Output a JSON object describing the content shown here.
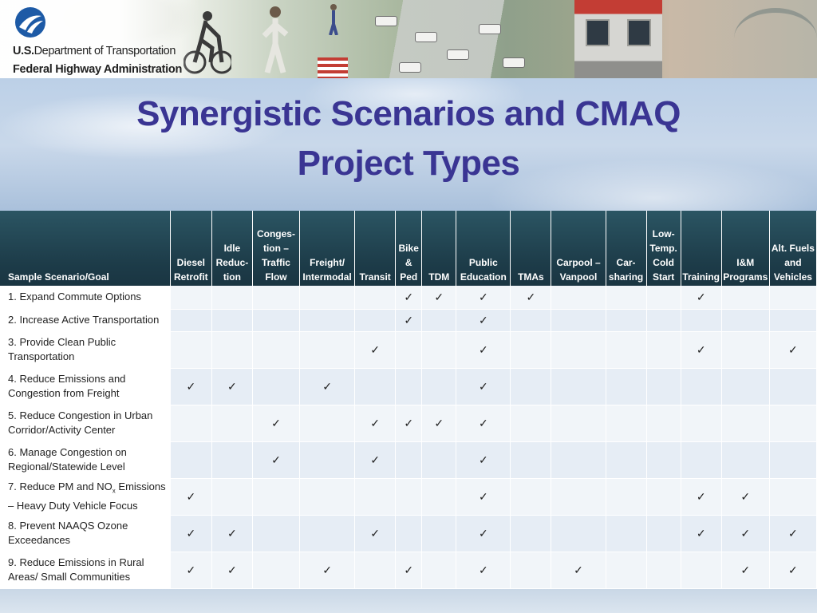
{
  "agency": {
    "line1_bold": "U.S.",
    "line1_rest": "Department of Transportation",
    "line2": "Federal Highway Administration"
  },
  "title": {
    "line1": "Synergistic Scenarios and CMAQ",
    "line2": "Project Types"
  },
  "table": {
    "headers": [
      [
        "Sample Scenario/Goal"
      ],
      [
        "Diesel",
        "Retrofit"
      ],
      [
        "Idle",
        "Reduc-",
        "tion"
      ],
      [
        "Conges-",
        "tion –",
        "Traffic",
        "Flow"
      ],
      [
        "Freight/",
        "Intermodal"
      ],
      [
        "Transit"
      ],
      [
        "Bike",
        "&",
        "Ped"
      ],
      [
        "TDM"
      ],
      [
        "Public",
        "Education"
      ],
      [
        "TMAs"
      ],
      [
        "Carpool –",
        "Vanpool"
      ],
      [
        "Car-",
        "sharing"
      ],
      [
        "Low-",
        "Temp.",
        "Cold",
        "Start"
      ],
      [
        "Training"
      ],
      [
        "I&M",
        "Programs"
      ],
      [
        "Alt. Fuels",
        "and",
        "Vehicles"
      ]
    ],
    "check_mark": "✓",
    "rows": [
      {
        "goal_lines": [
          "1. Expand Commute Options"
        ],
        "checks": [
          0,
          0,
          0,
          0,
          0,
          1,
          1,
          1,
          1,
          0,
          0,
          0,
          1,
          0,
          0
        ]
      },
      {
        "goal_lines": [
          "2. Increase Active Transportation"
        ],
        "checks": [
          0,
          0,
          0,
          0,
          0,
          1,
          0,
          1,
          0,
          0,
          0,
          0,
          0,
          0,
          0
        ]
      },
      {
        "goal_lines": [
          "3. Provide Clean Public",
          "Transportation"
        ],
        "checks": [
          0,
          0,
          0,
          0,
          1,
          0,
          0,
          1,
          0,
          0,
          0,
          0,
          1,
          0,
          1
        ]
      },
      {
        "goal_lines": [
          "4. Reduce Emissions and",
          "Congestion from Freight"
        ],
        "checks": [
          1,
          1,
          0,
          1,
          0,
          0,
          0,
          1,
          0,
          0,
          0,
          0,
          0,
          0,
          0
        ]
      },
      {
        "goal_lines": [
          "5. Reduce Congestion in Urban",
          "Corridor/Activity Center"
        ],
        "checks": [
          0,
          0,
          1,
          0,
          1,
          1,
          1,
          1,
          0,
          0,
          0,
          0,
          0,
          0,
          0
        ]
      },
      {
        "goal_lines": [
          "6. Manage Congestion on",
          "Regional/Statewide Level"
        ],
        "checks": [
          0,
          0,
          1,
          0,
          1,
          0,
          0,
          1,
          0,
          0,
          0,
          0,
          0,
          0,
          0
        ]
      },
      {
        "goal_lines": [
          "7. Reduce PM and NO",
          "x",
          " Emissions",
          "– Heavy Duty Vehicle Focus"
        ],
        "checks": [
          1,
          0,
          0,
          0,
          0,
          0,
          0,
          1,
          0,
          0,
          0,
          0,
          1,
          1,
          0
        ]
      },
      {
        "goal_lines": [
          "8. Prevent NAAQS Ozone",
          "Exceedances"
        ],
        "checks": [
          1,
          1,
          0,
          0,
          1,
          0,
          0,
          1,
          0,
          0,
          0,
          0,
          1,
          1,
          1
        ]
      },
      {
        "goal_lines": [
          "9. Reduce Emissions in Rural",
          "Areas/ Small Communities"
        ],
        "checks": [
          1,
          1,
          0,
          1,
          0,
          1,
          0,
          1,
          0,
          1,
          0,
          0,
          0,
          1,
          1
        ]
      }
    ]
  }
}
